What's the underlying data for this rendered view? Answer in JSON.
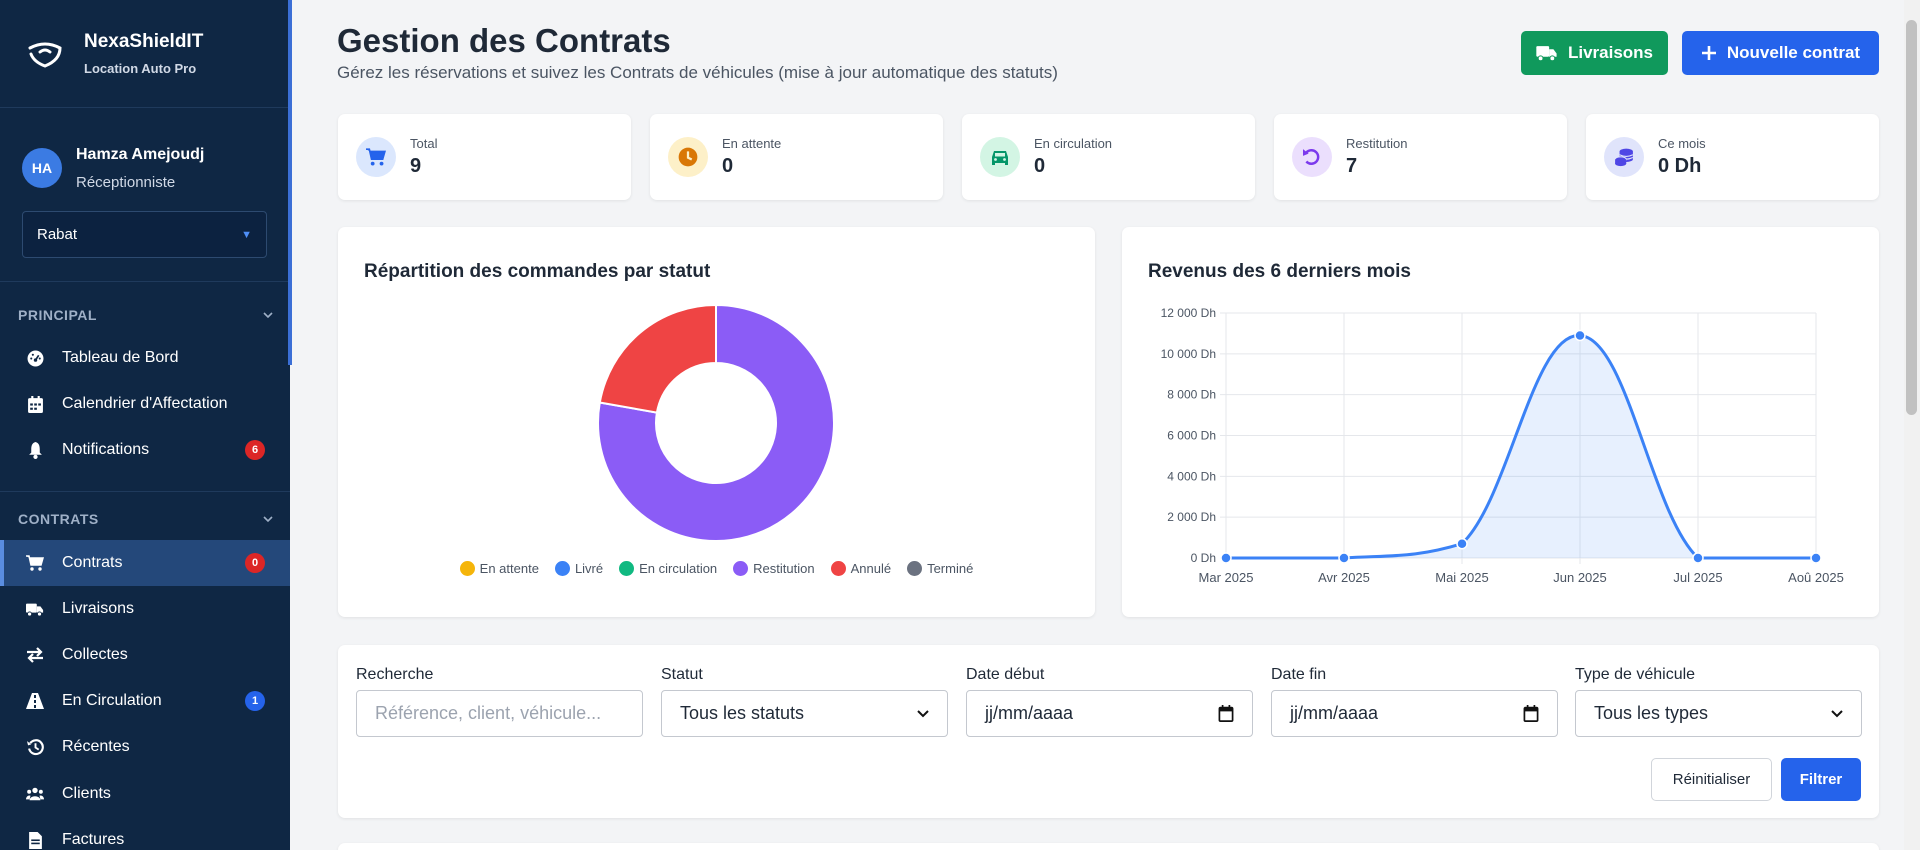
{
  "sidebar": {
    "brand_title": "NexaShieldIT",
    "brand_sub": "Location Auto Pro",
    "user_initials": "HA",
    "user_name": "Hamza Amejoudj",
    "user_role": "Réceptionniste",
    "agency": "Rabat",
    "section_principal": "PRINCIPAL",
    "section_contrats": "CONTRATS",
    "principal_items": [
      {
        "label": "Tableau de Bord",
        "icon": "gauge-icon"
      },
      {
        "label": "Calendrier d'Affectation",
        "icon": "calendar-icon"
      },
      {
        "label": "Notifications",
        "icon": "bell-icon",
        "badge": "6"
      }
    ],
    "contrats_items": [
      {
        "label": "Contrats",
        "icon": "cart-icon",
        "badge": "0",
        "active": true
      },
      {
        "label": "Livraisons",
        "icon": "truck-icon"
      },
      {
        "label": "Collectes",
        "icon": "exchange-icon"
      },
      {
        "label": "En Circulation",
        "icon": "road-icon",
        "badge": "1"
      },
      {
        "label": "Récentes",
        "icon": "history-icon"
      },
      {
        "label": "Clients",
        "icon": "users-icon"
      },
      {
        "label": "Factures",
        "icon": "invoice-icon"
      }
    ]
  },
  "header": {
    "title": "Gestion des Contrats",
    "subtitle": "Gérez les réservations et suivez les Contrats de véhicules (mise à jour automatique des statuts)",
    "livraisons_label": "Livraisons",
    "new_contract_label": "Nouvelle contrat"
  },
  "stats": [
    {
      "label": "Total",
      "value": "9",
      "icon": "cart-icon",
      "color": "#2563eb",
      "bg": "#dbe7fd"
    },
    {
      "label": "En attente",
      "value": "0",
      "icon": "clock-icon",
      "color": "#d97706",
      "bg": "#fdf0c8"
    },
    {
      "label": "En circulation",
      "value": "0",
      "icon": "car-icon",
      "color": "#059669",
      "bg": "#d3f5e4"
    },
    {
      "label": "Restitution",
      "value": "7",
      "icon": "undo-icon",
      "color": "#7c3aed",
      "bg": "#ebdffd"
    },
    {
      "label": "Ce mois",
      "value": "0 Dh",
      "icon": "coins-icon",
      "color": "#4f46e5",
      "bg": "#e0e4fb"
    }
  ],
  "colors": {
    "sidebar_bg": "#0f2744",
    "primary": "#2563eb",
    "success": "#10995c"
  },
  "chart_data": [
    {
      "type": "pie",
      "title": "Répartition des commandes par statut",
      "donut": true,
      "legend_position": "bottom",
      "categories": [
        "En attente",
        "Livré",
        "En circulation",
        "Restitution",
        "Annulé",
        "Terminé"
      ],
      "values": [
        0,
        0,
        0,
        7,
        2,
        0
      ],
      "colors": [
        "#f5b50a",
        "#3b82f6",
        "#10b981",
        "#8b5cf6",
        "#ef4444",
        "#6b7280"
      ]
    },
    {
      "type": "line",
      "title": "Revenus des 6 derniers mois",
      "categories": [
        "Mar 2025",
        "Avr 2025",
        "Mai 2025",
        "Jun 2025",
        "Jul 2025",
        "Aoû 2025"
      ],
      "values": [
        0,
        0,
        700,
        10900,
        0,
        0
      ],
      "ylim": [
        0,
        12000
      ],
      "yticks": [
        "0 Dh",
        "2 000 Dh",
        "4 000 Dh",
        "6 000 Dh",
        "8 000 Dh",
        "10 000 Dh",
        "12 000 Dh"
      ],
      "grid": true,
      "area": true,
      "color": "#3b82f6"
    }
  ],
  "filters": {
    "search_label": "Recherche",
    "search_placeholder": "Référence, client, véhicule...",
    "status_label": "Statut",
    "status_value": "Tous les statuts",
    "date_start_label": "Date début",
    "date_start_value": "jj/mm/aaaa",
    "date_end_label": "Date fin",
    "date_end_value": "jj/mm/aaaa",
    "vehicle_type_label": "Type de véhicule",
    "vehicle_type_value": "Tous les types",
    "reset_label": "Réinitialiser",
    "filter_label": "Filtrer"
  }
}
